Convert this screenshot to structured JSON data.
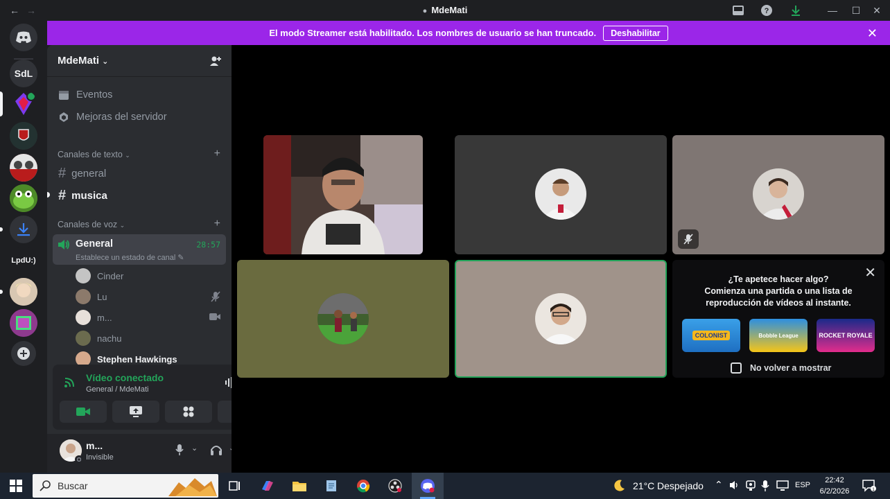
{
  "window": {
    "title": "MdeMati",
    "nav_back": "←",
    "nav_forward": "→",
    "minimize": "—",
    "maximize": "☐",
    "close": "✕"
  },
  "banner": {
    "text": "El modo Streamer está habilitado. Los nombres de usuario se han truncado.",
    "button": "Deshabilitar",
    "close": "✕",
    "color": "#9b26e8"
  },
  "rail": {
    "servers": [
      {
        "label": "SdL"
      },
      {
        "label": "LpdU:)"
      }
    ]
  },
  "server": {
    "name": "MdeMati",
    "menu": [
      {
        "label": "Eventos",
        "icon": "calendar-icon"
      },
      {
        "label": "Mejoras del servidor",
        "icon": "boost-icon"
      }
    ],
    "text_category": "Canales de texto",
    "text_channels": [
      {
        "name": "general",
        "unread": false
      },
      {
        "name": "musica",
        "unread": true
      }
    ],
    "voice_category": "Canales de voz",
    "voice_channel": {
      "name": "General",
      "timer": "28:57",
      "status": "Establece un estado de canal"
    },
    "voice_users": [
      {
        "name": "Cinder"
      },
      {
        "name": "Lu"
      },
      {
        "name": "m..."
      },
      {
        "name": "nachu"
      },
      {
        "name": "Stephen Hawkings"
      }
    ]
  },
  "voice_panel": {
    "status": "Vídeo conectado",
    "location": "General / MdeMati",
    "accent": "#23a55a"
  },
  "user_panel": {
    "name": "m...",
    "status": "Invisible"
  },
  "activity": {
    "title": "¿Te apetece hacer algo?",
    "subtitle": "Comienza una partida o una lista de reproducción de vídeos al instante.",
    "games": [
      {
        "label": "COLONIST"
      },
      {
        "label": "Bobble League"
      },
      {
        "label": "ROCKET ROYALE"
      }
    ],
    "checkbox_label": "No volver a mostrar"
  },
  "taskbar": {
    "search_placeholder": "Buscar",
    "weather_temp": "21°C",
    "weather_desc": "Despejado",
    "language": "ESP",
    "time": "22:42",
    "date": "6/2/2026"
  }
}
